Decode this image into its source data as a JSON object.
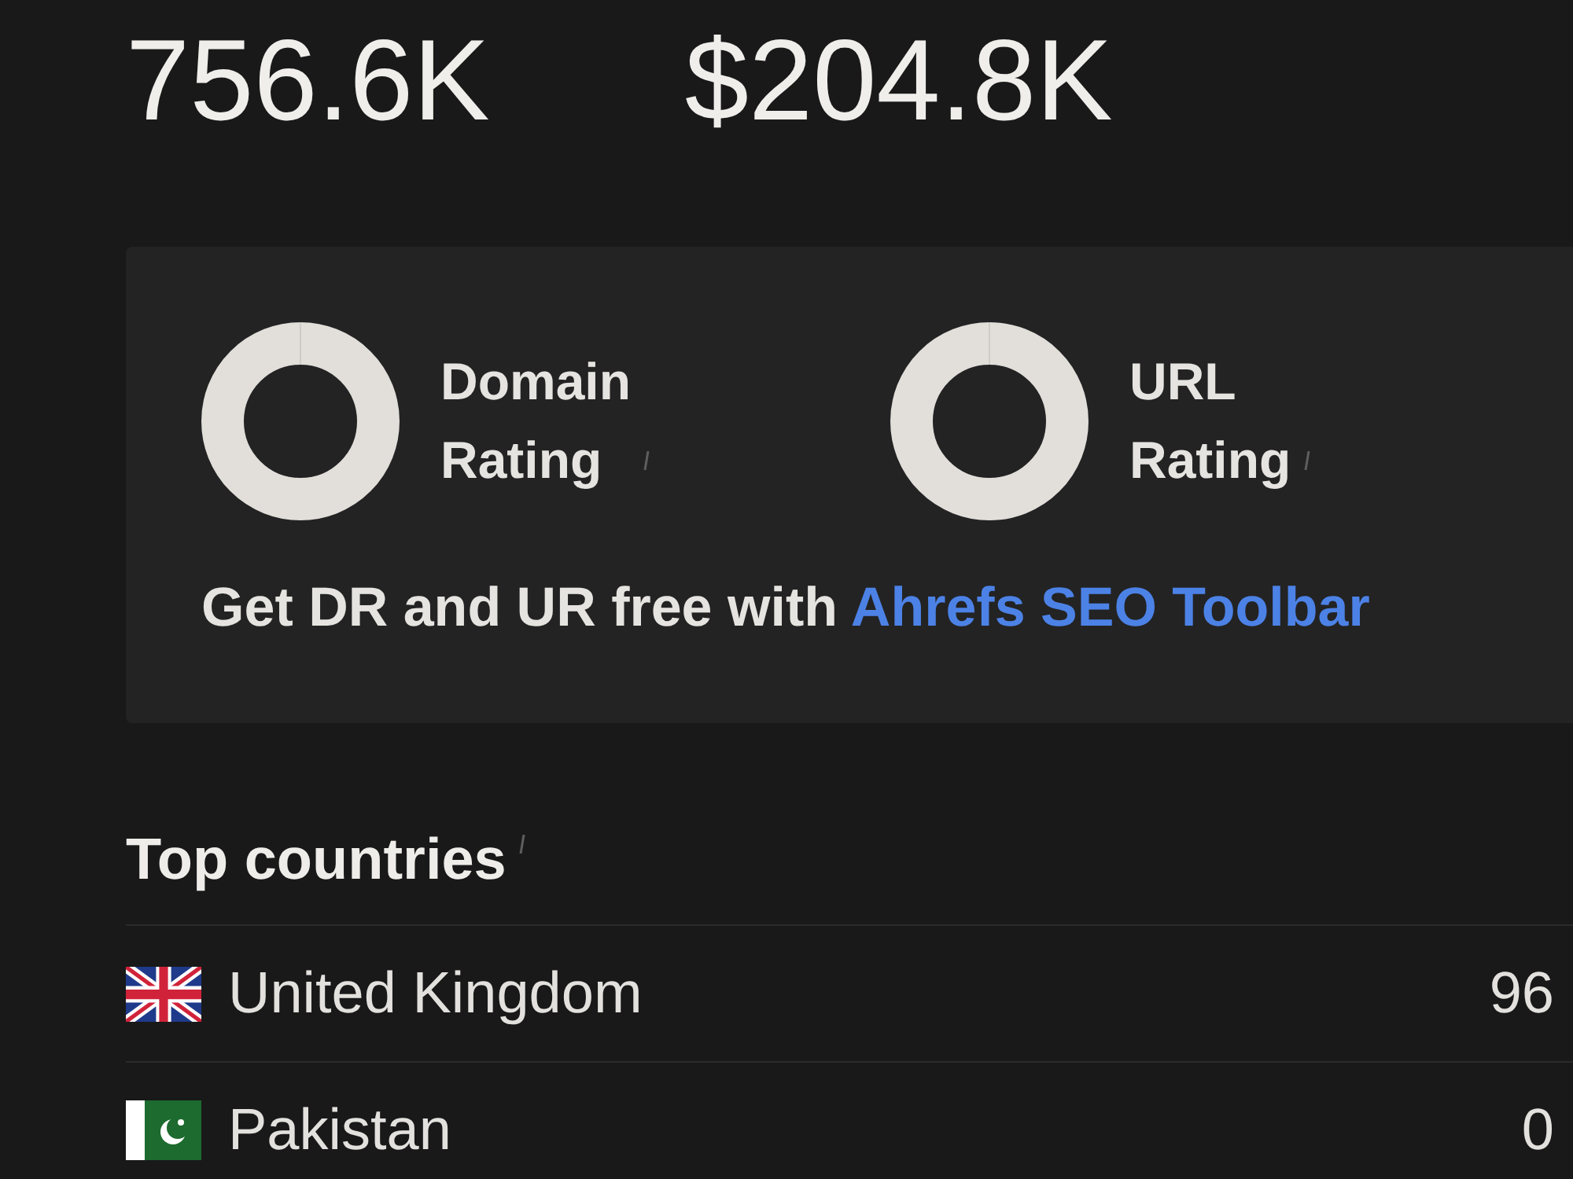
{
  "metrics": [
    {
      "value": "756.6K"
    },
    {
      "value": "$204.8K"
    }
  ],
  "ratings_card": {
    "ratings": [
      {
        "label": "Domain Rating"
      },
      {
        "label": "URL Rating"
      }
    ],
    "promo": {
      "text": "Get DR and UR free with",
      "link": "Ahrefs SEO Toolbar"
    }
  },
  "top_countries": {
    "title": "Top countries",
    "rows": [
      {
        "kind": "gb",
        "name": "United Kingdom",
        "value": "96"
      },
      {
        "kind": "pk",
        "name": "Pakistan",
        "value": "0"
      }
    ]
  }
}
